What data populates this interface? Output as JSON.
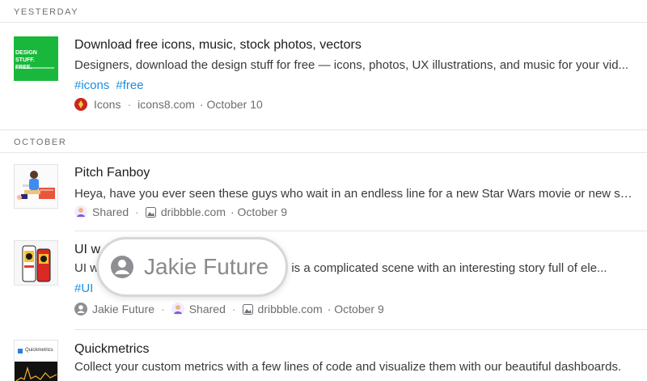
{
  "sections": [
    {
      "label": "YESTERDAY"
    },
    {
      "label": "OCTOBER"
    }
  ],
  "items": [
    {
      "thumb_text": "DESIGN STUFF. FREE.",
      "title": "Download free icons, music, stock photos, vectors",
      "description": "Designers, download the design stuff for free — icons, photos, UX illustrations, and music for your vid...",
      "tags": [
        "#icons",
        "#free"
      ],
      "source": "Icons",
      "domain": "icons8.com",
      "date": "· October 10"
    },
    {
      "title": "Pitch Fanboy",
      "description": "Heya, have you ever seen these guys who wait in an endless line for a new Star Wars movie or new sn...",
      "collection": "Shared",
      "domain": "dribbble.com",
      "date": "· October 9"
    },
    {
      "title": "UI w",
      "description_start": "UI w",
      "description_end": "tion is a complicated scene with an interesting story full of ele...",
      "tags": [
        "#UI"
      ],
      "author": "Jakie Future",
      "collection": "Shared",
      "domain": "dribbble.com",
      "date": "· October 9"
    },
    {
      "thumb_text": "Quickmetrics",
      "title": "Quickmetrics",
      "description": "Collect your custom metrics with a few lines of code and visualize them with our beautiful dashboards."
    }
  ],
  "callout": {
    "text": "Jakie Future",
    "icon": "person-icon"
  },
  "colors": {
    "tag": "#1d8de0",
    "divider": "#e6e6e8",
    "muted": "#6e6e73"
  }
}
